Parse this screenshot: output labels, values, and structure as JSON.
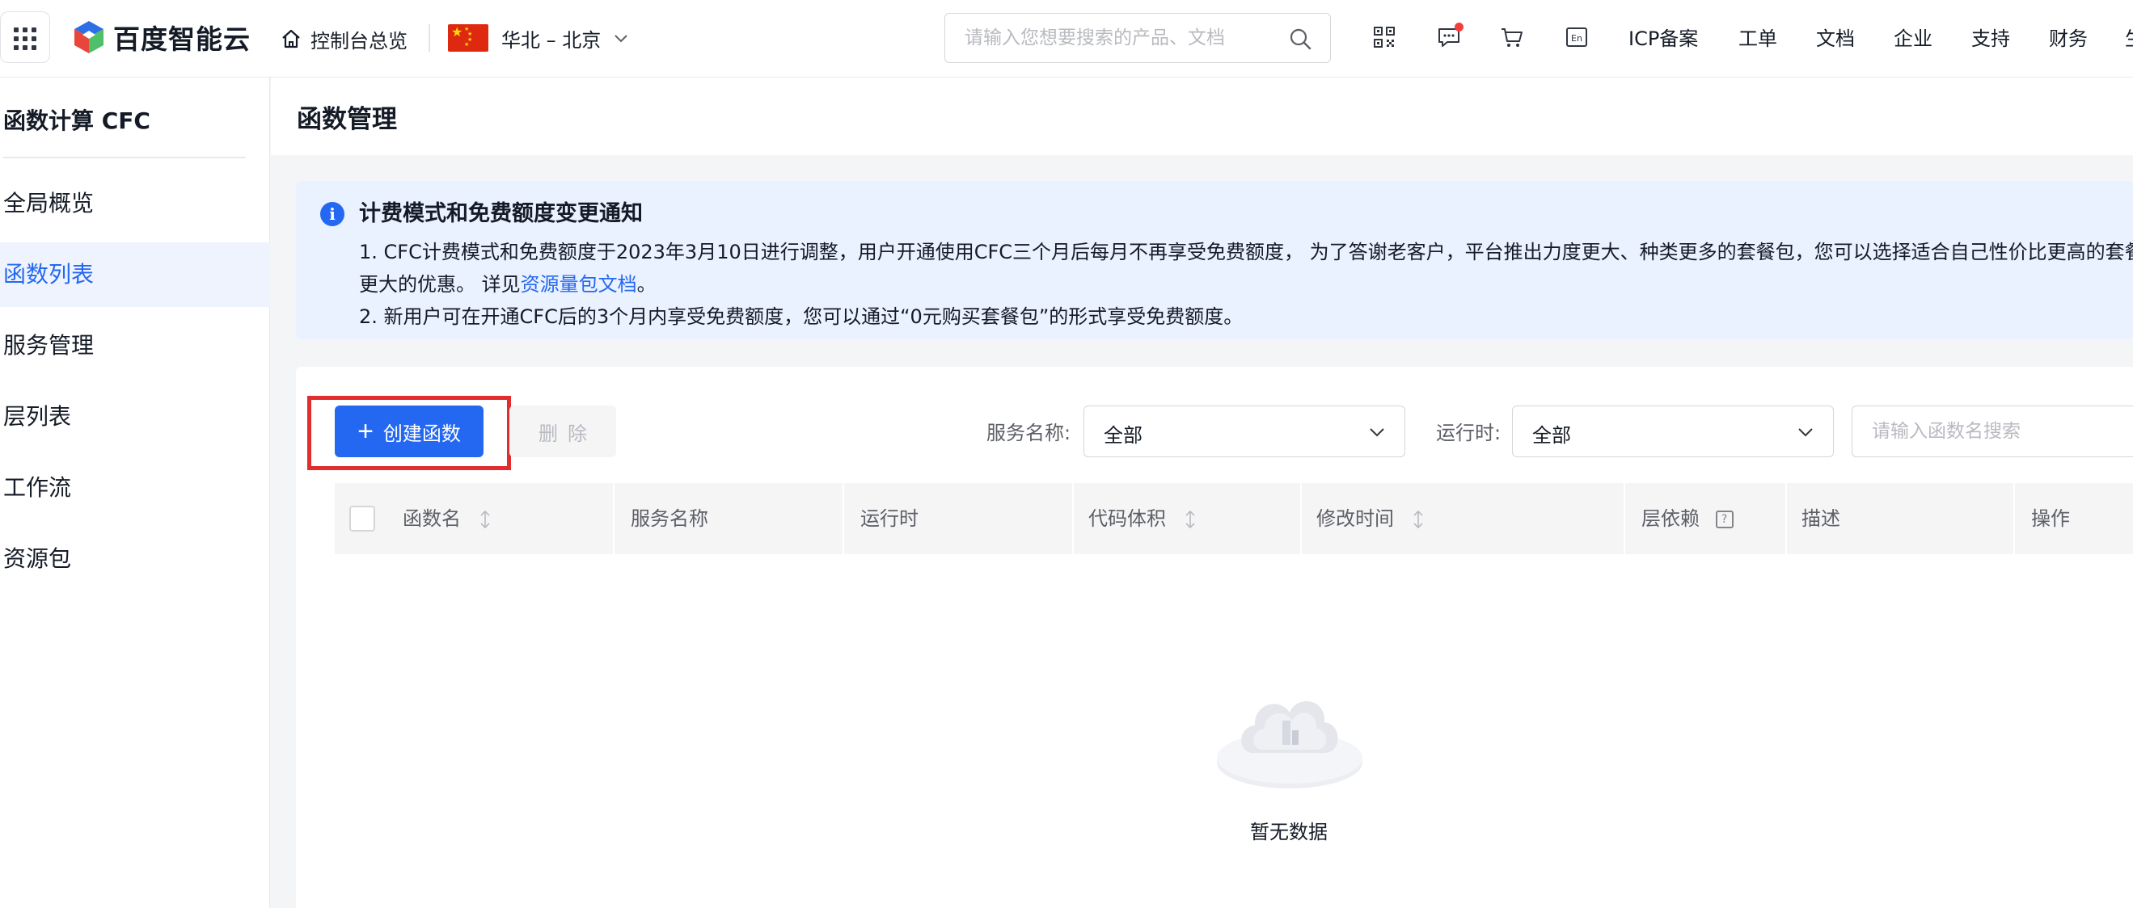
{
  "topbar": {
    "brand": "百度智能云",
    "overview": "控制台总览",
    "region": "华北 – 北京",
    "search_placeholder": "请输入您想要搜索的产品、文档",
    "links": [
      "ICP备案",
      "工单",
      "文档",
      "企业",
      "支持",
      "财务",
      "生"
    ]
  },
  "sidebar": {
    "title": "函数计算 CFC",
    "items": [
      "全局概览",
      "函数列表",
      "服务管理",
      "层列表",
      "工作流",
      "资源包"
    ],
    "active_index": 1
  },
  "main": {
    "page_title": "函数管理",
    "notice": {
      "title": "计费模式和免费额度变更通知",
      "line1": "1. CFC计费模式和免费额度于2023年3月10日进行调整，用户开通使用CFC三个月后每月不再享受免费额度， 为了答谢老客户，平台推出力度更大、种类更多的套餐包，您可以选择适合自己性价比更高的套餐",
      "line2_prefix": "更大的优惠。 详见",
      "line2_link": "资源量包文档",
      "line2_suffix": "。",
      "line3": "2. 新用户可在开通CFC后的3个月内享受免费额度，您可以通过“0元购买套餐包”的形式享受免费额度。"
    },
    "toolbar": {
      "create_label": "创建函数",
      "delete_label": "删除",
      "service_label": "服务名称:",
      "service_value": "全部",
      "runtime_label": "运行时:",
      "runtime_value": "全部",
      "search_placeholder": "请输入函数名搜索"
    },
    "table": {
      "columns": [
        "函数名",
        "服务名称",
        "运行时",
        "代码体积",
        "修改时间",
        "层依赖",
        "描述",
        "操作"
      ],
      "empty_text": "暂无数据"
    }
  },
  "colors": {
    "primary": "#2468f2",
    "highlight": "#e12d2d",
    "notice_bg": "#eaf1ff"
  }
}
